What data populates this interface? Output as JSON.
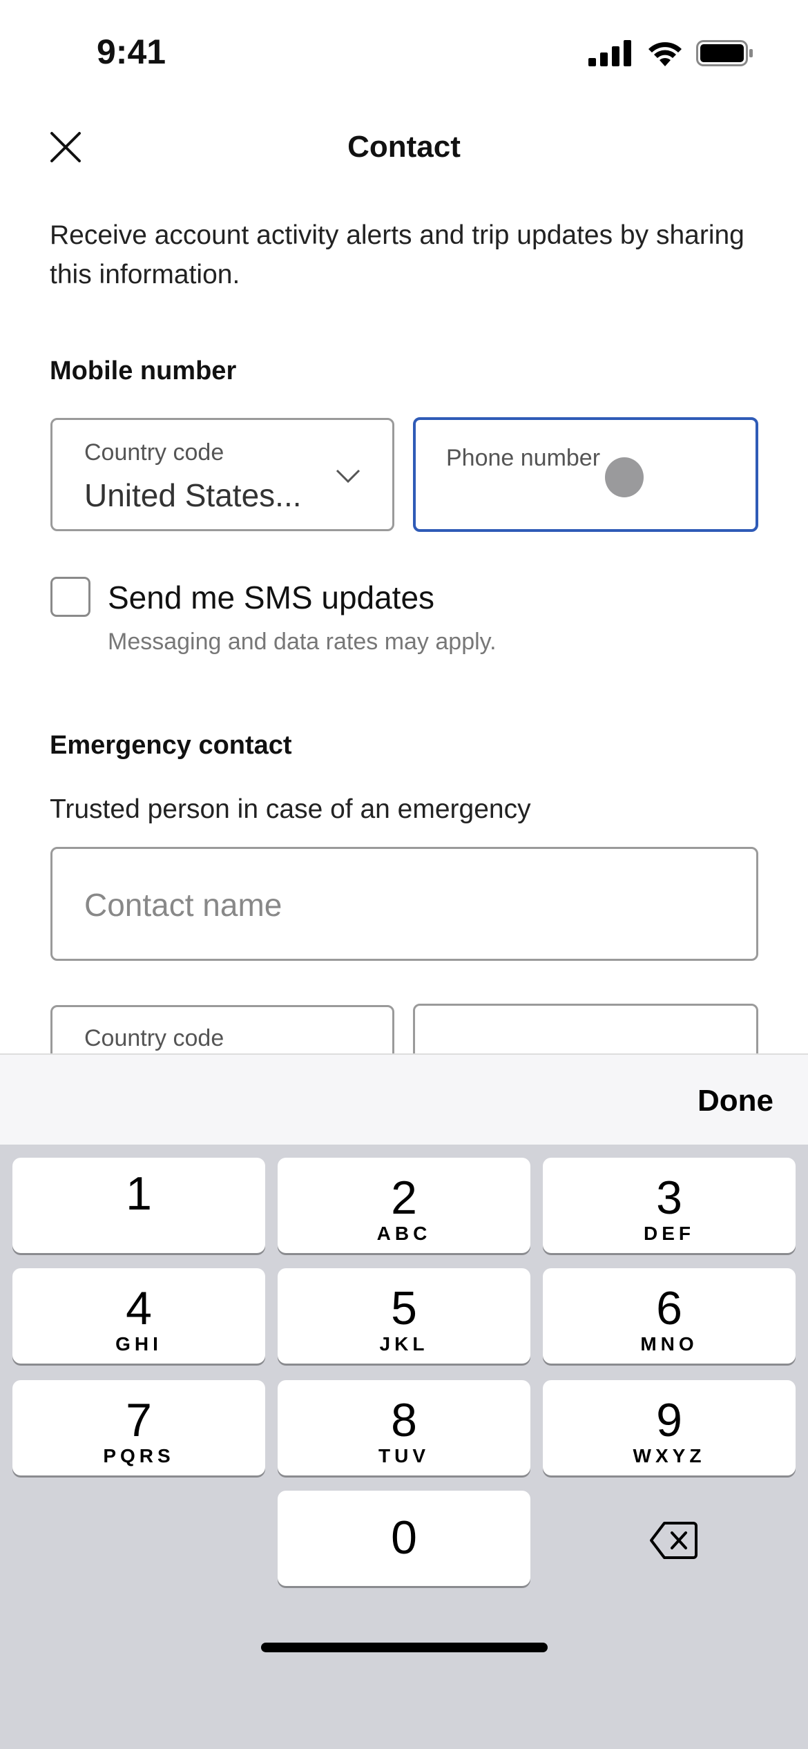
{
  "status_bar": {
    "time": "9:41"
  },
  "header": {
    "title": "Contact"
  },
  "description": "Receive account activity alerts and trip updates by sharing this information.",
  "mobile": {
    "heading": "Mobile number",
    "country_label": "Country code",
    "country_value": "United States...",
    "phone_label": "Phone number",
    "sms_label": "Send me SMS updates",
    "sms_checked": false,
    "sms_note": "Messaging and data rates may apply."
  },
  "emergency": {
    "heading": "Emergency contact",
    "subtitle": "Trusted person in case of an emergency",
    "name_placeholder": "Contact name",
    "country_label": "Country code"
  },
  "accent_color": "#2f5bb7",
  "keyboard": {
    "done": "Done",
    "keys": [
      {
        "d": "1",
        "l": ""
      },
      {
        "d": "2",
        "l": "ABC"
      },
      {
        "d": "3",
        "l": "DEF"
      },
      {
        "d": "4",
        "l": "GHI"
      },
      {
        "d": "5",
        "l": "JKL"
      },
      {
        "d": "6",
        "l": "MNO"
      },
      {
        "d": "7",
        "l": "PQRS"
      },
      {
        "d": "8",
        "l": "TUV"
      },
      {
        "d": "9",
        "l": "WXYZ"
      },
      {
        "d": "0",
        "l": ""
      }
    ],
    "delete_icon": "backspace-icon"
  }
}
